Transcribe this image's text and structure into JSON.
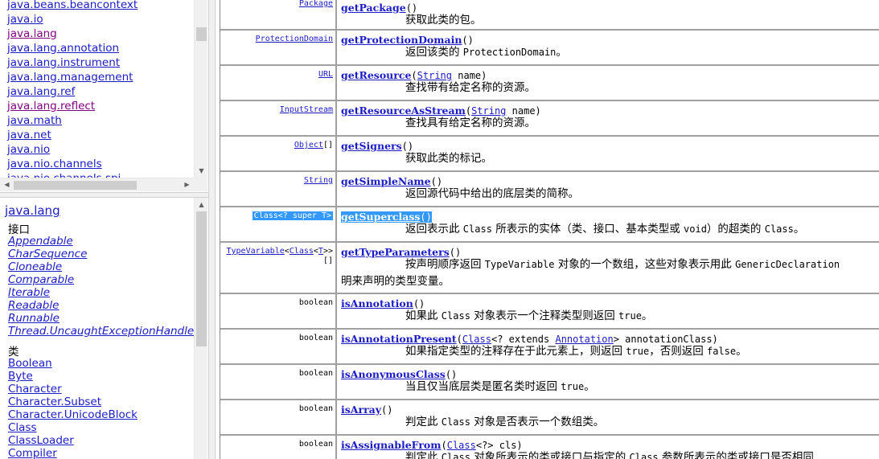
{
  "package_frame": {
    "packages": [
      {
        "label": "java.beans.beancontext",
        "visited": false
      },
      {
        "label": "java.io",
        "visited": false
      },
      {
        "label": "java.lang",
        "visited": true
      },
      {
        "label": "java.lang.annotation",
        "visited": false
      },
      {
        "label": "java.lang.instrument",
        "visited": false
      },
      {
        "label": "java.lang.management",
        "visited": false
      },
      {
        "label": "java.lang.ref",
        "visited": false
      },
      {
        "label": "java.lang.reflect",
        "visited": true
      },
      {
        "label": "java.math",
        "visited": false
      },
      {
        "label": "java.net",
        "visited": false
      },
      {
        "label": "java.nio",
        "visited": false
      },
      {
        "label": "java.nio.channels",
        "visited": false
      },
      {
        "label": "java.nio.channels.spi",
        "visited": false
      }
    ]
  },
  "class_frame": {
    "title": "java.lang",
    "interfaces_heading": "接口",
    "interfaces": [
      "Appendable",
      "CharSequence",
      "Cloneable",
      "Comparable",
      "Iterable",
      "Readable",
      "Runnable",
      "Thread.UncaughtExceptionHandler"
    ],
    "classes_heading": "类",
    "classes": [
      "Boolean",
      "Byte",
      "Character",
      "Character.Subset",
      "Character.UnicodeBlock",
      "Class",
      "ClassLoader",
      "Compiler"
    ]
  },
  "methods": [
    {
      "rtype": "Package",
      "name": "getPackage",
      "params_pre": "()",
      "params": [],
      "desc": "获取此类的包。"
    },
    {
      "rtype": "ProtectionDomain",
      "name": "getProtectionDomain",
      "params_pre": "()",
      "desc_text": "返回该类的 ",
      "desc_code": "ProtectionDomain",
      "desc_after": "。"
    },
    {
      "rtype": "URL",
      "name": "getResource",
      "param_type": "String",
      "param_name": " name)",
      "desc": "查找带有给定名称的资源。"
    },
    {
      "rtype": "InputStream",
      "name": "getResourceAsStream",
      "param_type": "String",
      "param_name": " name)",
      "desc": "查找具有给定名称的资源。"
    },
    {
      "rtype": "Object",
      "rtype_suffix": "[]",
      "name": "getSigners",
      "params_pre": "()",
      "desc": "获取此类的标记。"
    },
    {
      "rtype": "String",
      "name": "getSimpleName",
      "params_pre": "()",
      "desc": "返回源代码中给出的底层类的简称。"
    },
    {
      "rtype": "Class<? super T>",
      "name": "getSuperclass",
      "params_pre": "()",
      "selected": true,
      "desc_a": "返回表示此 ",
      "code_a": "Class",
      "desc_b": " 所表示的实体（类、接口、基本类型或 ",
      "code_b": "void",
      "desc_c": "）的超类的 ",
      "code_c": "Class",
      "desc_d": "。"
    },
    {
      "rtype_a": "TypeVariable",
      "rtype_b": "<",
      "rtype_c": "Class",
      "rtype_d": "<",
      "rtype_e": "T",
      "rtype_f": ">>",
      "rtype_g": "[]",
      "name": "getTypeParameters",
      "params_pre": "()",
      "desc_a": "按声明顺序返回 ",
      "code_a": "TypeVariable",
      "desc_b": " 对象的一个数组，这些对象表示用此 ",
      "code_b": "GenericDeclaration",
      "desc_line2": "明来声明的类型变量。"
    },
    {
      "rtype": "boolean",
      "name": "isAnnotation",
      "params_pre": "()",
      "desc_a": "如果此 ",
      "code_a": "Class",
      "desc_b": " 对象表示一个注释类型则返回 ",
      "code_b": "true",
      "desc_c": "。"
    },
    {
      "rtype": "boolean",
      "name": "isAnnotationPresent",
      "param_type": "Class",
      "param_mid": "<? extends ",
      "param_type2": "Annotation",
      "param_name": "> annotationClass)",
      "desc_a": "如果指定类型的注释存在于此元素上，则返回 ",
      "code_a": "true",
      "desc_b": "，否则返回 ",
      "code_b": "false",
      "desc_c": "。"
    },
    {
      "rtype": "boolean",
      "name": "isAnonymousClass",
      "params_pre": "()",
      "desc_a": "当且仅当底层类是匿名类时返回 ",
      "code_a": "true",
      "desc_b": "。"
    },
    {
      "rtype": "boolean",
      "name": "isArray",
      "params_pre": "()",
      "desc_a": "判定此 ",
      "code_a": "Class",
      "desc_b": " 对象是否表示一个数组类。"
    },
    {
      "rtype": "boolean",
      "name": "isAssignableFrom",
      "param_type": "Class",
      "param_name": "<?> cls)",
      "desc_a": "判定此 ",
      "code_a": "Class",
      "desc_b": " 对象所表示的类或接口与指定的 ",
      "code_b": "Class",
      "desc_c": " 参数所表示的类或接口是否相同"
    }
  ],
  "colors": {
    "link": "#1b1bc8",
    "visited": "#800080",
    "selection": "#3399ff",
    "scrollbar": "#f0f0f0",
    "thumb": "#cdcdcd"
  }
}
